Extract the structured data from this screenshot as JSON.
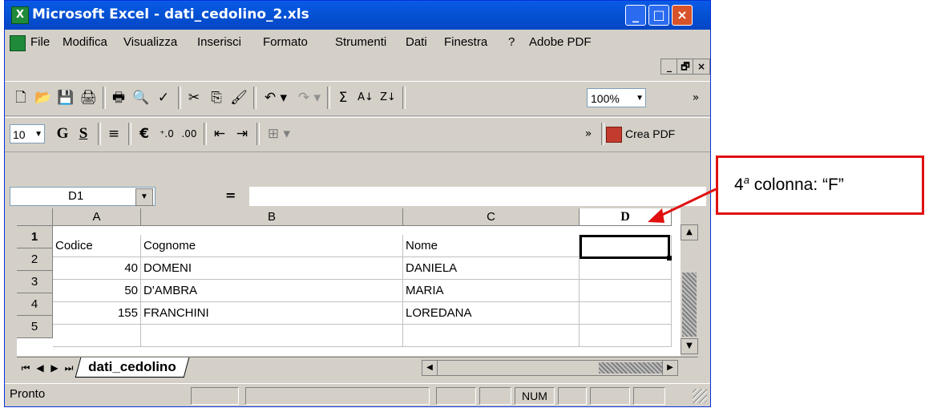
{
  "window": {
    "title": "Microsoft Excel - dati_cedolino_2.xls",
    "app_icon_glyph": "X",
    "controls": {
      "minimize": "_",
      "maximize": "□",
      "close": "×"
    }
  },
  "menubar": {
    "items": [
      "File",
      "Modifica",
      "Visualizza",
      "Inserisci",
      "Formato",
      "Strumenti",
      "Dati",
      "Finestra",
      "?",
      "Adobe PDF"
    ],
    "doc_controls": {
      "minimize": "_",
      "restore": "🗗",
      "close": "×"
    }
  },
  "toolbar_standard": {
    "icons": [
      "new-icon",
      "open-icon",
      "save-icon",
      "permission-icon",
      "print-icon",
      "print-preview-icon",
      "spelling-icon",
      "cut-icon",
      "copy-icon",
      "format-painter-icon",
      "undo-icon",
      "redo-icon",
      "autosum-icon",
      "sort-ascending-icon",
      "sort-descending-icon"
    ],
    "zoom": "100%",
    "overflow": "»"
  },
  "toolbar_formatting": {
    "font_size": "10",
    "bold_label": "G",
    "underline_label": "S",
    "overflow": "»",
    "crea_pdf_label": "Crea PDF"
  },
  "formula_bar": {
    "name_box": "D1",
    "equals": "=",
    "value": ""
  },
  "sheet": {
    "columns": [
      {
        "label": "A",
        "selected": false
      },
      {
        "label": "B",
        "selected": false
      },
      {
        "label": "C",
        "selected": false
      },
      {
        "label": "D",
        "selected": true
      }
    ],
    "rows": [
      {
        "num": "1",
        "selected": true,
        "cells": [
          "Codice",
          "Cognome",
          "Nome",
          ""
        ]
      },
      {
        "num": "2",
        "selected": false,
        "cells": [
          "40",
          "DOMENI",
          "DANIELA",
          ""
        ]
      },
      {
        "num": "3",
        "selected": false,
        "cells": [
          "50",
          "D'AMBRA",
          "MARIA",
          ""
        ]
      },
      {
        "num": "4",
        "selected": false,
        "cells": [
          "155",
          "FRANCHINI",
          "LOREDANA",
          ""
        ]
      },
      {
        "num": "5",
        "selected": false,
        "cells": [
          "",
          "",
          "",
          ""
        ]
      }
    ],
    "active_cell": "D1"
  },
  "sheet_tabs": {
    "nav": [
      "⏮",
      "◀",
      "▶",
      "⏭"
    ],
    "tabs": [
      "dati_cedolino"
    ]
  },
  "status_bar": {
    "text": "Pronto",
    "num_indicator": "NUM"
  },
  "annotation": {
    "number": "4",
    "superscript": "a",
    "text": " colonna: “F”",
    "color": "#e01010"
  }
}
